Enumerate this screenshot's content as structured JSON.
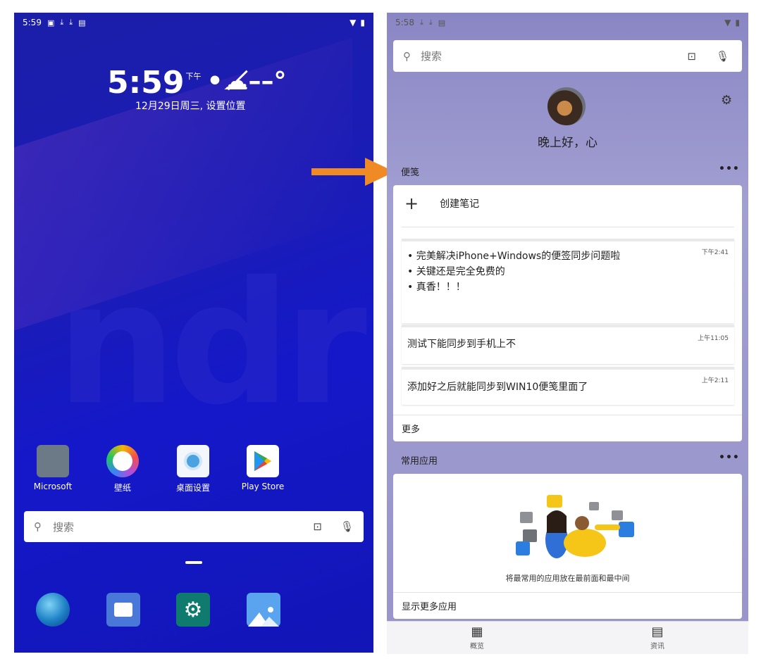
{
  "left": {
    "status": {
      "time": "5:59"
    },
    "clock": {
      "time": "5:59",
      "ampm": "下午",
      "weather": "•☁̸––°"
    },
    "date": "12月29日周三, 设置位置",
    "apps": [
      {
        "label": "Microsoft",
        "icon": "microsoft-folder-icon"
      },
      {
        "label": "壁纸",
        "icon": "wallpaper-icon"
      },
      {
        "label": "桌面设置",
        "icon": "launcher-settings-icon"
      },
      {
        "label": "Play Store",
        "icon": "play-store-icon"
      }
    ],
    "search_placeholder": "搜索",
    "dock": [
      "edge-browser-icon",
      "camera-icon",
      "settings-icon",
      "gallery-icon"
    ]
  },
  "right": {
    "status": {
      "time": "5:58"
    },
    "search_placeholder": "搜索",
    "greeting": "晚上好，心",
    "notes_section": {
      "title": "便笺",
      "create_label": "创建笔记",
      "notes": [
        {
          "lines": [
            "• 完美解决iPhone+Windows的便签同步问题啦",
            "• 关键还是完全免费的",
            "• 真香！！！"
          ],
          "time": "下午2:41"
        },
        {
          "lines": [
            "测试下能同步到手机上不"
          ],
          "time": "上午11:05"
        },
        {
          "lines": [
            "添加好之后就能同步到WIN10便笺里面了"
          ],
          "time": "上午2:11"
        }
      ],
      "more_label": "更多"
    },
    "apps_section": {
      "title": "常用应用",
      "caption": "将最常用的应用放在最前面和最中间",
      "more_label": "显示更多应用"
    },
    "nav": [
      {
        "label": "概览",
        "icon": "glance-grid-icon"
      },
      {
        "label": "资讯",
        "icon": "news-icon"
      }
    ]
  },
  "colors": {
    "left_bg": "#1418c9",
    "right_bg": "#9c99cf",
    "arrow": "#f08a24"
  }
}
